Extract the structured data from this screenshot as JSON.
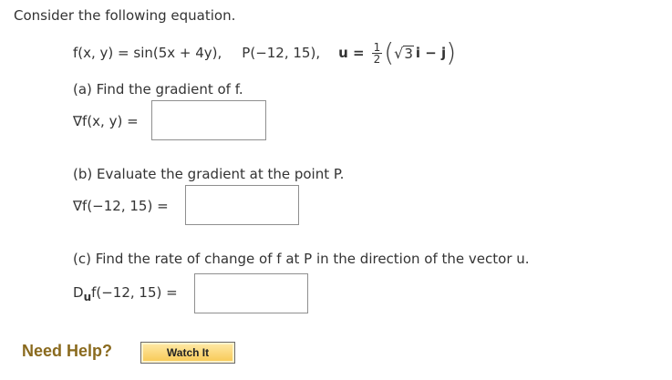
{
  "intro": "Consider the following equation.",
  "equation": {
    "function": "f(x, y) = sin(5x + 4y),",
    "point": "P(−12, 15),",
    "vector_label": "u =",
    "frac_num": "1",
    "frac_den": "2",
    "sqrt_radicand": "3",
    "vector_tail": "i − j"
  },
  "parts": {
    "a": {
      "question": "(a) Find the gradient of f.",
      "answer_label": "∇f(x, y) ="
    },
    "b": {
      "question": "(b) Evaluate the gradient at the point P.",
      "answer_label": "∇f(−12, 15) ="
    },
    "c": {
      "question": "(c) Find the rate of change of f at P in the direction of the vector u.",
      "answer_label_pre": "D",
      "answer_label_sub": "u",
      "answer_label_post": "f(−12, 15) ="
    }
  },
  "help": {
    "need_help": "Need Help?",
    "watch_button": "Watch It"
  }
}
